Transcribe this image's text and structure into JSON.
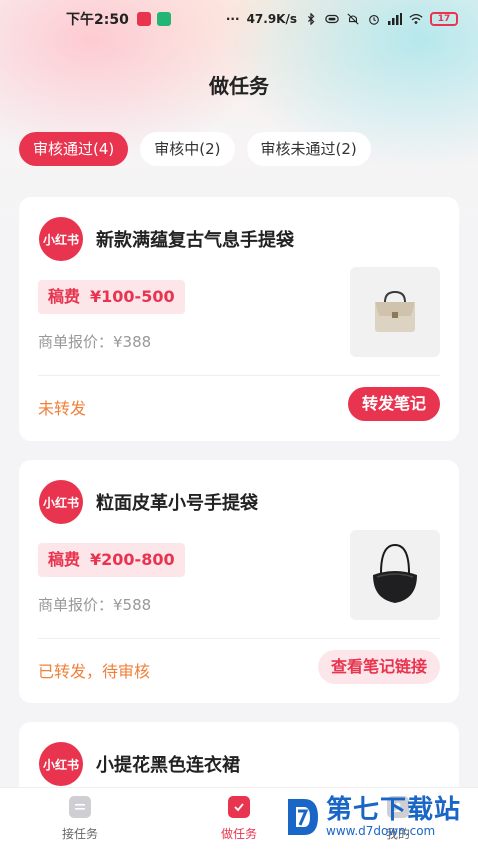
{
  "status_bar": {
    "time": "下午2:50",
    "dots": "···",
    "network_speed": "47.9K/s",
    "battery": "17",
    "icons": [
      "tiktok-icon",
      "app-icon",
      "bluetooth-icon",
      "vibrate-icon",
      "mute-icon",
      "alarm-icon",
      "signal-icon",
      "wifi-icon",
      "battery-icon"
    ]
  },
  "header": {
    "title": "做任务"
  },
  "filters": [
    {
      "label": "审核通过(4)",
      "active": true
    },
    {
      "label": "审核中(2)",
      "active": false
    },
    {
      "label": "审核未通过(2)",
      "active": false
    }
  ],
  "tasks": [
    {
      "brand": "小红书",
      "title": "新款满蕴复古气息手提袋",
      "fee_label": "稿费",
      "fee_range": "¥100-500",
      "quote": "商单报价：¥388",
      "thumb_icon": "beige-handbag-image",
      "status": "未转发",
      "action": "转发笔记"
    },
    {
      "brand": "小红书",
      "title": "粒面皮革小号手提袋",
      "fee_label": "稿费",
      "fee_range": "¥200-800",
      "quote": "商单报价：¥588",
      "thumb_icon": "black-handbag-image",
      "status": "已转发，待审核",
      "action": "查看笔记链接"
    },
    {
      "brand": "小红书",
      "title": "小提花黑色连衣裙"
    }
  ],
  "tabbar": [
    {
      "label": "接任务",
      "icon": "task-list-icon",
      "active": false
    },
    {
      "label": "做任务",
      "icon": "task-check-icon",
      "active": true
    },
    {
      "label": "我的",
      "icon": "profile-icon",
      "active": false
    }
  ],
  "watermark": {
    "main": "第七下载站",
    "url": "www.d7down.com"
  },
  "colors": {
    "accent": "#e8344e",
    "status_orange": "#f0813a",
    "watermark_blue": "#1a66c7"
  }
}
